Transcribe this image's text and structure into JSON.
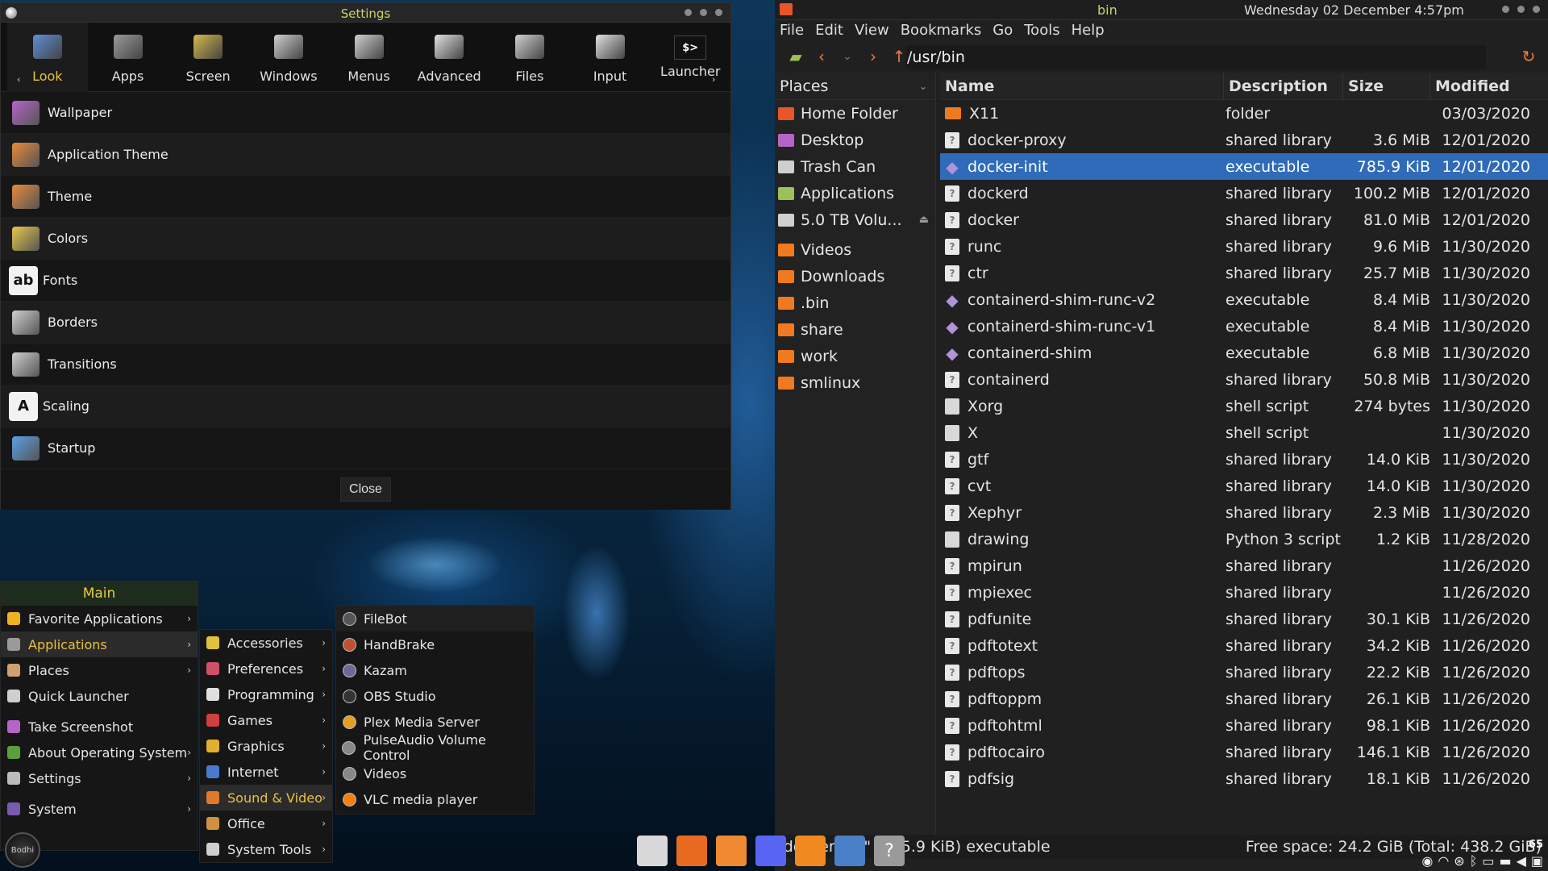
{
  "settings": {
    "title": "Settings",
    "toolbar": [
      {
        "label": "Look",
        "icon": "look-icon"
      },
      {
        "label": "Apps",
        "icon": "gear-icon"
      },
      {
        "label": "Screen",
        "icon": "screen-icon"
      },
      {
        "label": "Windows",
        "icon": "windows-icon"
      },
      {
        "label": "Menus",
        "icon": "menus-icon"
      },
      {
        "label": "Advanced",
        "icon": "advanced-icon"
      },
      {
        "label": "Files",
        "icon": "files-icon"
      },
      {
        "label": "Input",
        "icon": "input-icon"
      },
      {
        "label": "Launcher",
        "icon": "terminal-icon",
        "glyph": "$>"
      }
    ],
    "items": [
      {
        "label": "Wallpaper",
        "icon": "wallpaper-icon"
      },
      {
        "label": "Application Theme",
        "icon": "application-theme-icon"
      },
      {
        "label": "Theme",
        "icon": "theme-icon"
      },
      {
        "label": "Colors",
        "icon": "colors-icon"
      },
      {
        "label": "Fonts",
        "icon": "fonts-icon",
        "glyph": "ab"
      },
      {
        "label": "Borders",
        "icon": "borders-icon"
      },
      {
        "label": "Transitions",
        "icon": "transitions-icon"
      },
      {
        "label": "Scaling",
        "icon": "scaling-icon",
        "glyph": "A"
      },
      {
        "label": "Startup",
        "icon": "startup-icon"
      }
    ],
    "close_label": "Close"
  },
  "filemanager": {
    "title": "bin",
    "clock": "Wednesday 02 December  4:57pm",
    "menu": [
      "File",
      "Edit",
      "View",
      "Bookmarks",
      "Go",
      "Tools",
      "Help"
    ],
    "path": "/usr/bin",
    "places_label": "Places",
    "places": [
      {
        "label": "Home Folder",
        "icon": "home-folder-icon",
        "color": "#e8552b"
      },
      {
        "label": "Desktop",
        "icon": "desktop-icon",
        "color": "#b565c9"
      },
      {
        "label": "Trash Can",
        "icon": "trash-icon",
        "color": "#cfcfcf"
      },
      {
        "label": "Applications",
        "icon": "applications-icon",
        "color": "#9ac25a"
      },
      {
        "label": "5.0 TB Volu...",
        "icon": "drive-icon",
        "color": "#d0d0d0"
      },
      {
        "label": "Videos",
        "icon": "folder-icon",
        "color": "#f07a1f"
      },
      {
        "label": "Downloads",
        "icon": "folder-icon",
        "color": "#f07a1f"
      },
      {
        "label": ".bin",
        "icon": "folder-icon",
        "color": "#f07a1f"
      },
      {
        "label": "share",
        "icon": "folder-icon",
        "color": "#f07a1f"
      },
      {
        "label": "work",
        "icon": "folder-icon",
        "color": "#f07a1f"
      },
      {
        "label": "smlinux",
        "icon": "folder-icon",
        "color": "#f07a1f"
      }
    ],
    "columns": {
      "name": "Name",
      "description": "Description",
      "size": "Size",
      "modified": "Modified"
    },
    "files": [
      {
        "name": "X11",
        "desc": "folder",
        "size": "",
        "mod": "03/03/2020",
        "type": "folder"
      },
      {
        "name": "docker-proxy",
        "desc": "shared library",
        "size": "3.6 MiB",
        "mod": "12/01/2020",
        "type": "lib"
      },
      {
        "name": "docker-init",
        "desc": "executable",
        "size": "785.9 KiB",
        "mod": "12/01/2020",
        "type": "exe",
        "selected": true
      },
      {
        "name": "dockerd",
        "desc": "shared library",
        "size": "100.2 MiB",
        "mod": "12/01/2020",
        "type": "lib"
      },
      {
        "name": "docker",
        "desc": "shared library",
        "size": "81.0 MiB",
        "mod": "12/01/2020",
        "type": "lib"
      },
      {
        "name": "runc",
        "desc": "shared library",
        "size": "9.6 MiB",
        "mod": "11/30/2020",
        "type": "lib"
      },
      {
        "name": "ctr",
        "desc": "shared library",
        "size": "25.7 MiB",
        "mod": "11/30/2020",
        "type": "lib"
      },
      {
        "name": "containerd-shim-runc-v2",
        "desc": "executable",
        "size": "8.4 MiB",
        "mod": "11/30/2020",
        "type": "exe"
      },
      {
        "name": "containerd-shim-runc-v1",
        "desc": "executable",
        "size": "8.4 MiB",
        "mod": "11/30/2020",
        "type": "exe"
      },
      {
        "name": "containerd-shim",
        "desc": "executable",
        "size": "6.8 MiB",
        "mod": "11/30/2020",
        "type": "exe"
      },
      {
        "name": "containerd",
        "desc": "shared library",
        "size": "50.8 MiB",
        "mod": "11/30/2020",
        "type": "lib"
      },
      {
        "name": "Xorg",
        "desc": "shell script",
        "size": "274 bytes",
        "mod": "11/30/2020",
        "type": "script"
      },
      {
        "name": "X",
        "desc": "shell script",
        "size": "",
        "mod": "11/30/2020",
        "type": "script"
      },
      {
        "name": "gtf",
        "desc": "shared library",
        "size": "14.0 KiB",
        "mod": "11/30/2020",
        "type": "lib"
      },
      {
        "name": "cvt",
        "desc": "shared library",
        "size": "14.0 KiB",
        "mod": "11/30/2020",
        "type": "lib"
      },
      {
        "name": "Xephyr",
        "desc": "shared library",
        "size": "2.3 MiB",
        "mod": "11/30/2020",
        "type": "lib"
      },
      {
        "name": "drawing",
        "desc": "Python 3 script",
        "size": "1.2 KiB",
        "mod": "11/28/2020",
        "type": "script"
      },
      {
        "name": "mpirun",
        "desc": "shared library",
        "size": "",
        "mod": "11/26/2020",
        "type": "lib"
      },
      {
        "name": "mpiexec",
        "desc": "shared library",
        "size": "",
        "mod": "11/26/2020",
        "type": "lib"
      },
      {
        "name": "pdfunite",
        "desc": "shared library",
        "size": "30.1 KiB",
        "mod": "11/26/2020",
        "type": "lib"
      },
      {
        "name": "pdftotext",
        "desc": "shared library",
        "size": "34.2 KiB",
        "mod": "11/26/2020",
        "type": "lib"
      },
      {
        "name": "pdftops",
        "desc": "shared library",
        "size": "22.2 KiB",
        "mod": "11/26/2020",
        "type": "lib"
      },
      {
        "name": "pdftoppm",
        "desc": "shared library",
        "size": "26.1 KiB",
        "mod": "11/26/2020",
        "type": "lib"
      },
      {
        "name": "pdftohtml",
        "desc": "shared library",
        "size": "98.1 KiB",
        "mod": "11/26/2020",
        "type": "lib"
      },
      {
        "name": "pdftocairo",
        "desc": "shared library",
        "size": "146.1 KiB",
        "mod": "11/26/2020",
        "type": "lib"
      },
      {
        "name": "pdfsig",
        "desc": "shared library",
        "size": "18.1 KiB",
        "mod": "11/26/2020",
        "type": "lib"
      }
    ],
    "status_left": "\"docker-init\" (785.9 KiB) executable",
    "status_right": "Free space: 24.2 GiB (Total: 438.2 GiB)"
  },
  "main_menu": {
    "title": "Main",
    "items": [
      {
        "label": "Favorite Applications",
        "icon": "star-icon",
        "arrow": true
      },
      {
        "label": "Applications",
        "icon": "gear-icon",
        "arrow": true,
        "highlight": true
      },
      {
        "label": "Places",
        "icon": "places-icon",
        "arrow": true
      },
      {
        "label": "Quick Launcher",
        "icon": "quick-launcher-icon",
        "arrow": false
      },
      {
        "label": "Take Screenshot",
        "icon": "screenshot-icon",
        "arrow": false
      },
      {
        "label": "About Operating System",
        "icon": "about-icon",
        "arrow": true
      },
      {
        "label": "Settings",
        "icon": "settings-icon",
        "arrow": true
      },
      {
        "label": "System",
        "icon": "system-icon",
        "arrow": true
      }
    ]
  },
  "applications_menu": {
    "items": [
      {
        "label": "Accessories",
        "icon": "accessories-icon"
      },
      {
        "label": "Preferences",
        "icon": "preferences-icon"
      },
      {
        "label": "Programming",
        "icon": "programming-icon"
      },
      {
        "label": "Games",
        "icon": "games-icon"
      },
      {
        "label": "Graphics",
        "icon": "graphics-icon"
      },
      {
        "label": "Internet",
        "icon": "internet-icon"
      },
      {
        "label": "Sound & Video",
        "icon": "sound-video-icon",
        "highlight": true
      },
      {
        "label": "Office",
        "icon": "office-icon"
      },
      {
        "label": "System Tools",
        "icon": "system-tools-icon"
      }
    ]
  },
  "sound_video_menu": {
    "items": [
      {
        "label": "FileBot",
        "icon": "filebot-icon"
      },
      {
        "label": "HandBrake",
        "icon": "handbrake-icon"
      },
      {
        "label": "Kazam",
        "icon": "kazam-icon"
      },
      {
        "label": "OBS Studio",
        "icon": "obs-icon"
      },
      {
        "label": "Plex Media Server",
        "icon": "plex-icon"
      },
      {
        "label": "PulseAudio Volume Control",
        "icon": "pulseaudio-icon"
      },
      {
        "label": "Videos",
        "icon": "videos-icon"
      },
      {
        "label": "VLC media player",
        "icon": "vlc-icon"
      }
    ]
  },
  "taskbar": {
    "launcher_label": "Bodhi",
    "apps": [
      {
        "icon": "terminal-icon"
      },
      {
        "icon": "firefox-icon"
      },
      {
        "icon": "file-manager-icon"
      },
      {
        "icon": "discord-icon"
      },
      {
        "icon": "sublime-text-icon"
      },
      {
        "icon": "virtualbox-icon"
      },
      {
        "icon": "unknown-app-icon",
        "glyph": "?"
      }
    ],
    "battery": "65"
  }
}
